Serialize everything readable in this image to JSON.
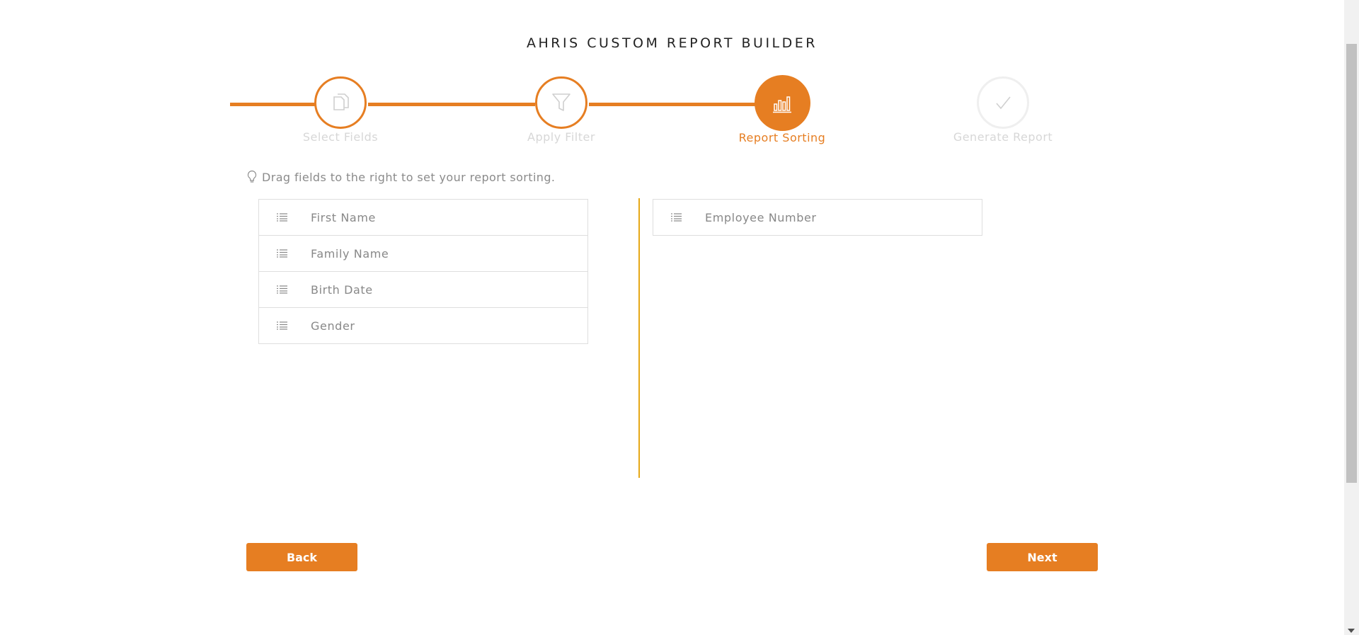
{
  "header": {
    "title": "AHRIS CUSTOM REPORT BUILDER"
  },
  "steps": [
    {
      "label": "Select Fields",
      "state": "done",
      "icon": "copy-icon"
    },
    {
      "label": "Apply Filter",
      "state": "done",
      "icon": "filter-icon"
    },
    {
      "label": "Report Sorting",
      "state": "active",
      "icon": "bar-chart-icon"
    },
    {
      "label": "Generate Report",
      "state": "pending",
      "icon": "check-icon"
    }
  ],
  "hint": {
    "text": "Drag fields to the right to set your report sorting.",
    "icon": "lightbulb-icon"
  },
  "available_fields": [
    {
      "label": "First Name"
    },
    {
      "label": "Family Name"
    },
    {
      "label": "Birth Date"
    },
    {
      "label": "Gender"
    }
  ],
  "sort_fields": [
    {
      "label": "Employee Number"
    }
  ],
  "buttons": {
    "back": "Back",
    "next": "Next"
  },
  "colors": {
    "accent": "#e67e22",
    "divider": "#e6a817",
    "muted_text": "#888888"
  }
}
